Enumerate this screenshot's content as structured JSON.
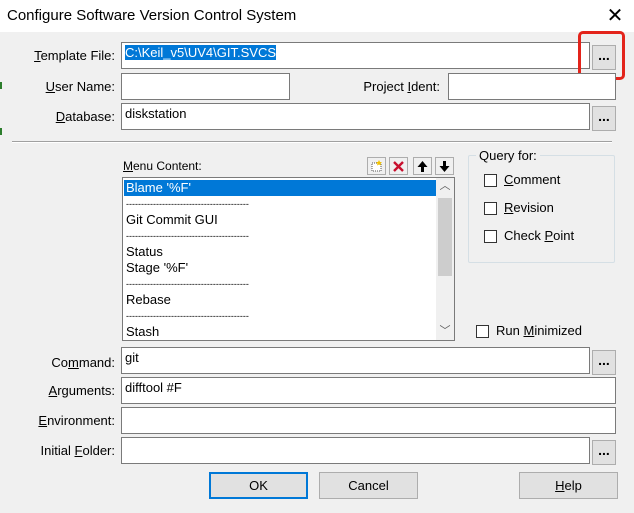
{
  "window": {
    "title": "Configure Software Version Control System",
    "close_glyph": "✕"
  },
  "form": {
    "template_file": {
      "label_pre": "",
      "label_ul": "T",
      "label_post": "emplate File:",
      "value": "C:\\Keil_v5\\UV4\\GIT.SVCS"
    },
    "user_name": {
      "label_pre": "",
      "label_ul": "U",
      "label_post": "ser Name:",
      "value": ""
    },
    "project_ident": {
      "label_pre": "Project ",
      "label_ul": "I",
      "label_post": "dent:",
      "value": ""
    },
    "database": {
      "label_pre": "",
      "label_ul": "D",
      "label_post": "atabase:",
      "value": "diskstation"
    },
    "command": {
      "label_pre": "Co",
      "label_ul": "m",
      "label_post": "mand:",
      "value": "git"
    },
    "arguments": {
      "label_pre": "",
      "label_ul": "A",
      "label_post": "rguments:",
      "value": "difftool #F"
    },
    "environment": {
      "label_pre": "",
      "label_ul": "E",
      "label_post": "nvironment:",
      "value": ""
    },
    "initial_folder": {
      "label_pre": "Initial ",
      "label_ul": "F",
      "label_post": "older:",
      "value": ""
    },
    "browse_glyph": "..."
  },
  "menu_content": {
    "label_pre": "",
    "label_ul": "M",
    "label_post": "enu Content:",
    "toolbar": {
      "new_icon": "new-item-icon",
      "delete_icon": "delete-icon",
      "up_icon": "move-up-icon",
      "down_icon": "move-down-icon"
    },
    "items": [
      "Blame '%F'",
      "-----------------------------------------",
      "Git Commit GUI",
      "-----------------------------------------",
      "Status",
      "Stage '%F'",
      "-----------------------------------------",
      "Rebase",
      "-----------------------------------------",
      "Stash"
    ],
    "selected_index": 0
  },
  "query_for": {
    "title": "Query for:",
    "comment": {
      "label_pre": "",
      "label_ul": "C",
      "label_post": "omment",
      "checked": false
    },
    "revision": {
      "label_pre": "",
      "label_ul": "R",
      "label_post": "evision",
      "checked": false
    },
    "check_point": {
      "label_pre": "Check ",
      "label_ul": "P",
      "label_post": "oint",
      "checked": false
    }
  },
  "run_minimized": {
    "label_pre": "Run ",
    "label_ul": "M",
    "label_post": "inimized",
    "checked": false
  },
  "buttons": {
    "ok": "OK",
    "cancel": "Cancel",
    "help_ul": "H",
    "help_post": "elp"
  },
  "colors": {
    "selection": "#0078d7",
    "highlight_box": "#e3241b"
  }
}
